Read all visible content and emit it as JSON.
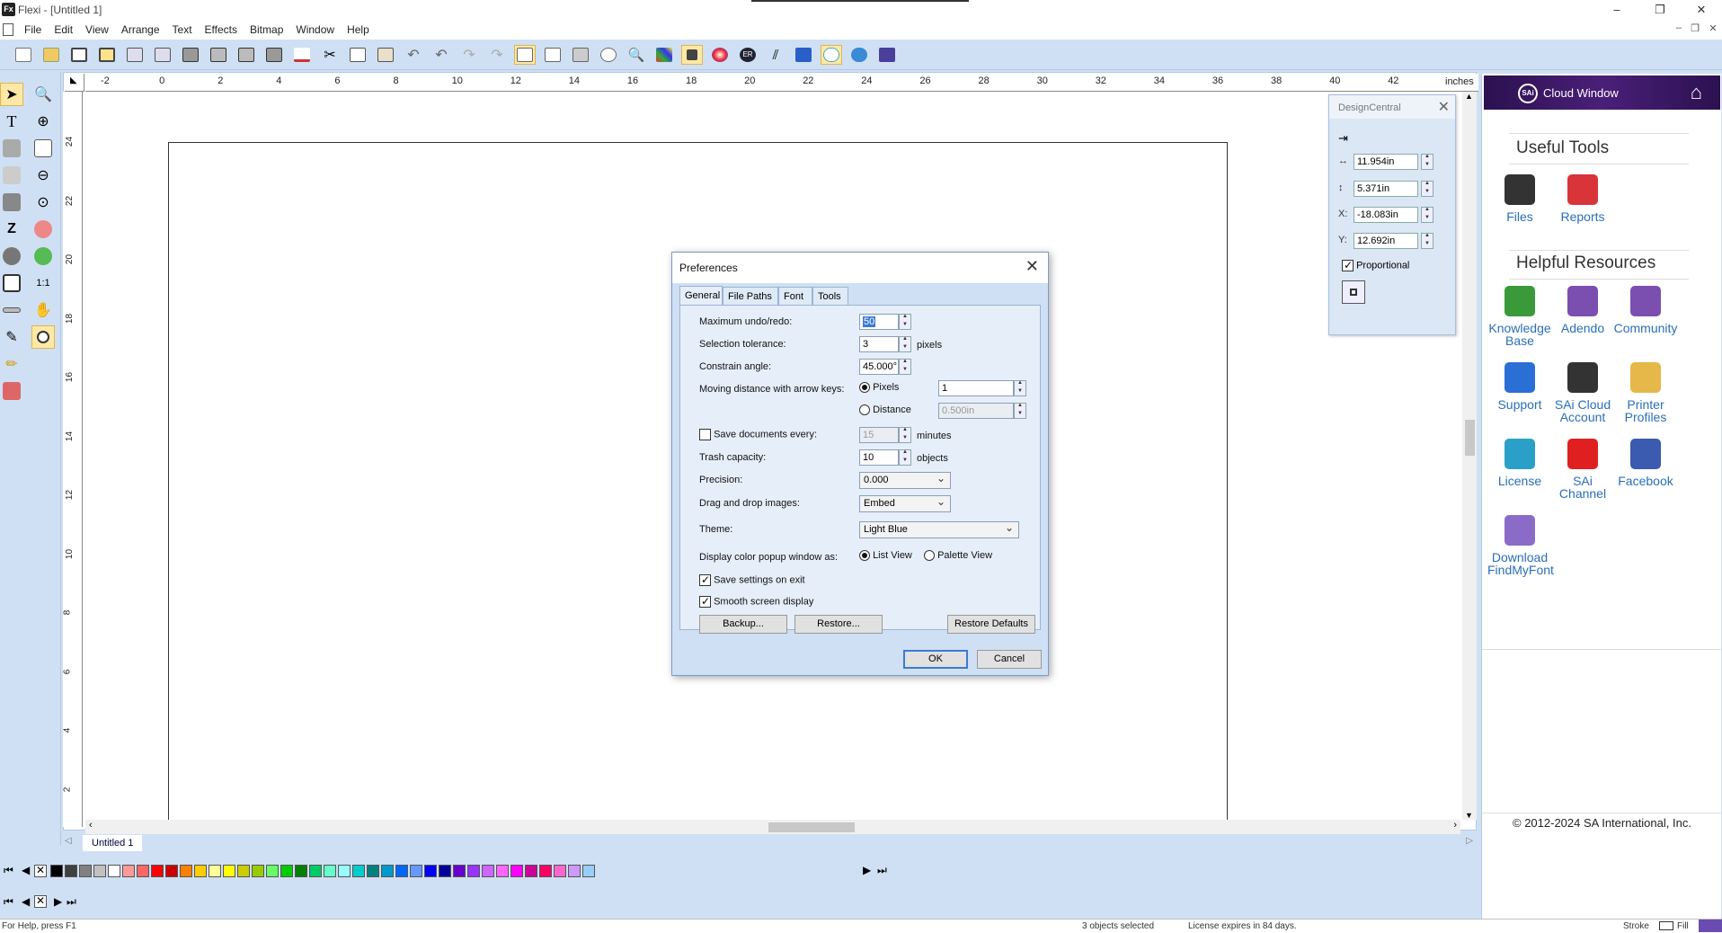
{
  "window": {
    "title": "Flexi - [Untitled 1]",
    "logo": "Fx"
  },
  "menu": [
    "File",
    "Edit",
    "View",
    "Arrange",
    "Text",
    "Effects",
    "Bitmap",
    "Window",
    "Help"
  ],
  "ruler": {
    "unit": "inches",
    "h_ticks": [
      "-2",
      "0",
      "2",
      "4",
      "6",
      "8",
      "10",
      "12",
      "14",
      "16",
      "18",
      "20",
      "22",
      "24",
      "26",
      "28",
      "30",
      "32",
      "34",
      "36",
      "38",
      "40",
      "42"
    ],
    "v_ticks": [
      "24",
      "22",
      "20",
      "18",
      "16",
      "14",
      "12",
      "10",
      "8",
      "6",
      "4",
      "2"
    ]
  },
  "design_central": {
    "title": "DesignCentral",
    "width": "11.954in",
    "height": "5.371in",
    "x_label": "X:",
    "x_value": "-18.083in",
    "y_label": "Y:",
    "y_value": "12.692in",
    "proportional_label": "Proportional",
    "proportional_checked": true
  },
  "cloud_window": {
    "title": "Cloud Window",
    "logo": "SAi",
    "useful_tools_heading": "Useful Tools",
    "useful_tools": [
      {
        "label": "Files",
        "icon": "files-icon",
        "color": "#333333"
      },
      {
        "label": "Reports",
        "icon": "reports-icon",
        "color": "#d9343a"
      }
    ],
    "helpful_heading": "Helpful Resources",
    "helpful": [
      {
        "label": "Knowledge Base",
        "icon": "knowledge-base-icon",
        "color": "#3a9a3a"
      },
      {
        "label": "Adendo",
        "icon": "adendo-icon",
        "color": "#7b4fb0"
      },
      {
        "label": "Community",
        "icon": "community-icon",
        "color": "#7b4fb0"
      },
      {
        "label": "Support",
        "icon": "support-icon",
        "color": "#2a6fd6"
      },
      {
        "label": "SAi Cloud Account",
        "icon": "cloud-account-icon",
        "color": "#333333"
      },
      {
        "label": "Printer Profiles",
        "icon": "printer-profiles-icon",
        "color": "#e6b84a"
      },
      {
        "label": "License",
        "icon": "license-icon",
        "color": "#2aa0c8"
      },
      {
        "label": "SAi Channel",
        "icon": "youtube-icon",
        "color": "#e02020"
      },
      {
        "label": "Facebook",
        "icon": "facebook-icon",
        "color": "#3b5bb0"
      },
      {
        "label": "Download FindMyFont",
        "icon": "findmyfont-icon",
        "color": "#8a6cc8"
      }
    ],
    "copyright": "© 2012-2024 SA International, Inc."
  },
  "preferences": {
    "title": "Preferences",
    "tabs": [
      "General",
      "File Paths",
      "Font",
      "Tools"
    ],
    "selected_tab": "General",
    "max_undo_label": "Maximum undo/redo:",
    "max_undo_value": "50",
    "selection_tolerance_label": "Selection tolerance:",
    "selection_tolerance_value": "3",
    "selection_tolerance_unit": "pixels",
    "constrain_angle_label": "Constrain angle:",
    "constrain_angle_value": "45.000°",
    "moving_distance_label": "Moving distance with arrow keys:",
    "pixels_label": "Pixels",
    "pixels_value": "1",
    "distance_label": "Distance",
    "distance_value": "0.500in",
    "save_docs_label": "Save documents every:",
    "save_docs_value": "15",
    "save_docs_unit": "minutes",
    "trash_capacity_label": "Trash capacity:",
    "trash_capacity_value": "10",
    "trash_capacity_unit": "objects",
    "precision_label": "Precision:",
    "precision_value": "0.000",
    "drag_drop_label": "Drag and drop images:",
    "drag_drop_value": "Embed",
    "theme_label": "Theme:",
    "theme_value": "Light Blue",
    "display_popup_label": "Display color popup window as:",
    "list_view_label": "List View",
    "palette_view_label": "Palette View",
    "save_settings_label": "Save settings on exit",
    "smooth_display_label": "Smooth screen display",
    "backup_button": "Backup...",
    "restore_button": "Restore...",
    "restore_defaults_button": "Restore Defaults",
    "ok_button": "OK",
    "cancel_button": "Cancel"
  },
  "document_tab": "Untitled 1",
  "palette_colors": [
    "#000000",
    "#404040",
    "#808080",
    "#c0c0c0",
    "#ffffff",
    "#ff9999",
    "#ff6666",
    "#ff0000",
    "#cc0000",
    "#ff8000",
    "#ffcc00",
    "#ffff99",
    "#ffff00",
    "#cccc00",
    "#99cc00",
    "#66ff66",
    "#00cc00",
    "#008000",
    "#00cc66",
    "#66ffcc",
    "#99ffff",
    "#00cccc",
    "#008080",
    "#0099cc",
    "#0066ff",
    "#6699ff",
    "#0000ff",
    "#000099",
    "#6600cc",
    "#9933ff",
    "#cc66ff",
    "#ff66ff",
    "#ff00ff",
    "#cc0099",
    "#ff0066",
    "#ff66cc",
    "#cc99ff",
    "#99ccff"
  ],
  "status": {
    "help": "For Help, press F1",
    "selection": "3 objects selected",
    "license": "License expires in 84 days.",
    "stroke": "Stroke",
    "fill": "Fill"
  }
}
